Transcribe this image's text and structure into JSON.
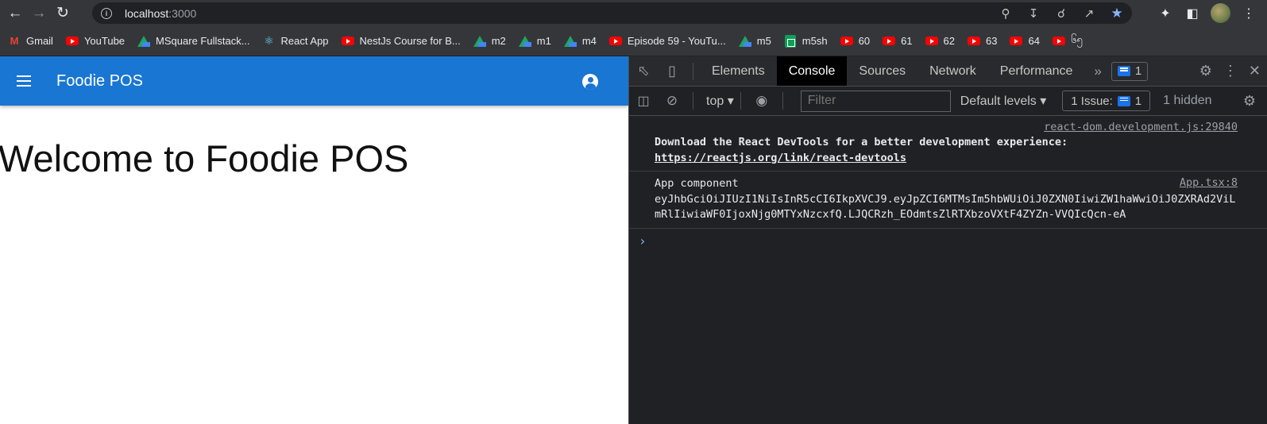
{
  "browser": {
    "url_host": "localhost",
    "url_port": ":3000",
    "toolbar_icons": [
      "back-icon",
      "forward-icon",
      "reload-icon"
    ],
    "omnibox_icons": [
      "key-icon",
      "install-icon",
      "zoom-icon",
      "share-icon",
      "star-icon"
    ],
    "right_icons": [
      "extensions-icon",
      "side-panel-icon",
      "avatar",
      "menu-icon"
    ],
    "accent": "#8ab4f8"
  },
  "bookmarks": [
    {
      "label": "Gmail",
      "icon": "gmail"
    },
    {
      "label": "YouTube",
      "icon": "youtube"
    },
    {
      "label": "MSquare Fullstack...",
      "icon": "drive"
    },
    {
      "label": "React App",
      "icon": "react"
    },
    {
      "label": "NestJs Course for B...",
      "icon": "youtube"
    },
    {
      "label": "m2",
      "icon": "drive"
    },
    {
      "label": "m1",
      "icon": "drive"
    },
    {
      "label": "m4",
      "icon": "drive"
    },
    {
      "label": "Episode 59 - YouTu...",
      "icon": "youtube"
    },
    {
      "label": "m5",
      "icon": "drive"
    },
    {
      "label": "m5sh",
      "icon": "sheets"
    },
    {
      "label": "60",
      "icon": "youtube"
    },
    {
      "label": "61",
      "icon": "youtube"
    },
    {
      "label": "62",
      "icon": "youtube"
    },
    {
      "label": "63",
      "icon": "youtube"
    },
    {
      "label": "64",
      "icon": "youtube"
    },
    {
      "label": "၆၅",
      "icon": "youtube"
    }
  ],
  "app": {
    "title": "Foodie POS",
    "welcome": "Welcome to Foodie POS",
    "primary_color": "#1976d2"
  },
  "devtools": {
    "tabs": [
      "Elements",
      "Console",
      "Sources",
      "Network",
      "Performance"
    ],
    "active_tab": "Console",
    "issues_badge": "1",
    "context": "top",
    "filter_placeholder": "Filter",
    "levels": "Default levels",
    "issue_label": "1 Issue:",
    "issue_count": "1",
    "hidden": "1 hidden",
    "logs": [
      {
        "source": "react-dom.development.js:29840",
        "text": "Download the React DevTools for a better development experience: ",
        "link": "https://reactjs.org/link/react-devtools"
      },
      {
        "source": "App.tsx:8",
        "text": "App component",
        "token": "eyJhbGciOiJIUzI1NiIsInR5cCI6IkpXVCJ9.eyJpZCI6MTMsIm5hbWUiOiJ0ZXN0IiwiZW1haWwiOiJ0ZXRAd2ViLmRlIiwiaWF0IjoxNjg0MTYxNzcxfQ.LJQCRzh_EOdmtsZlRTXbzoVXtF4ZYZn-VVQIcQcn-eA"
      }
    ],
    "prompt_symbol": "›"
  }
}
